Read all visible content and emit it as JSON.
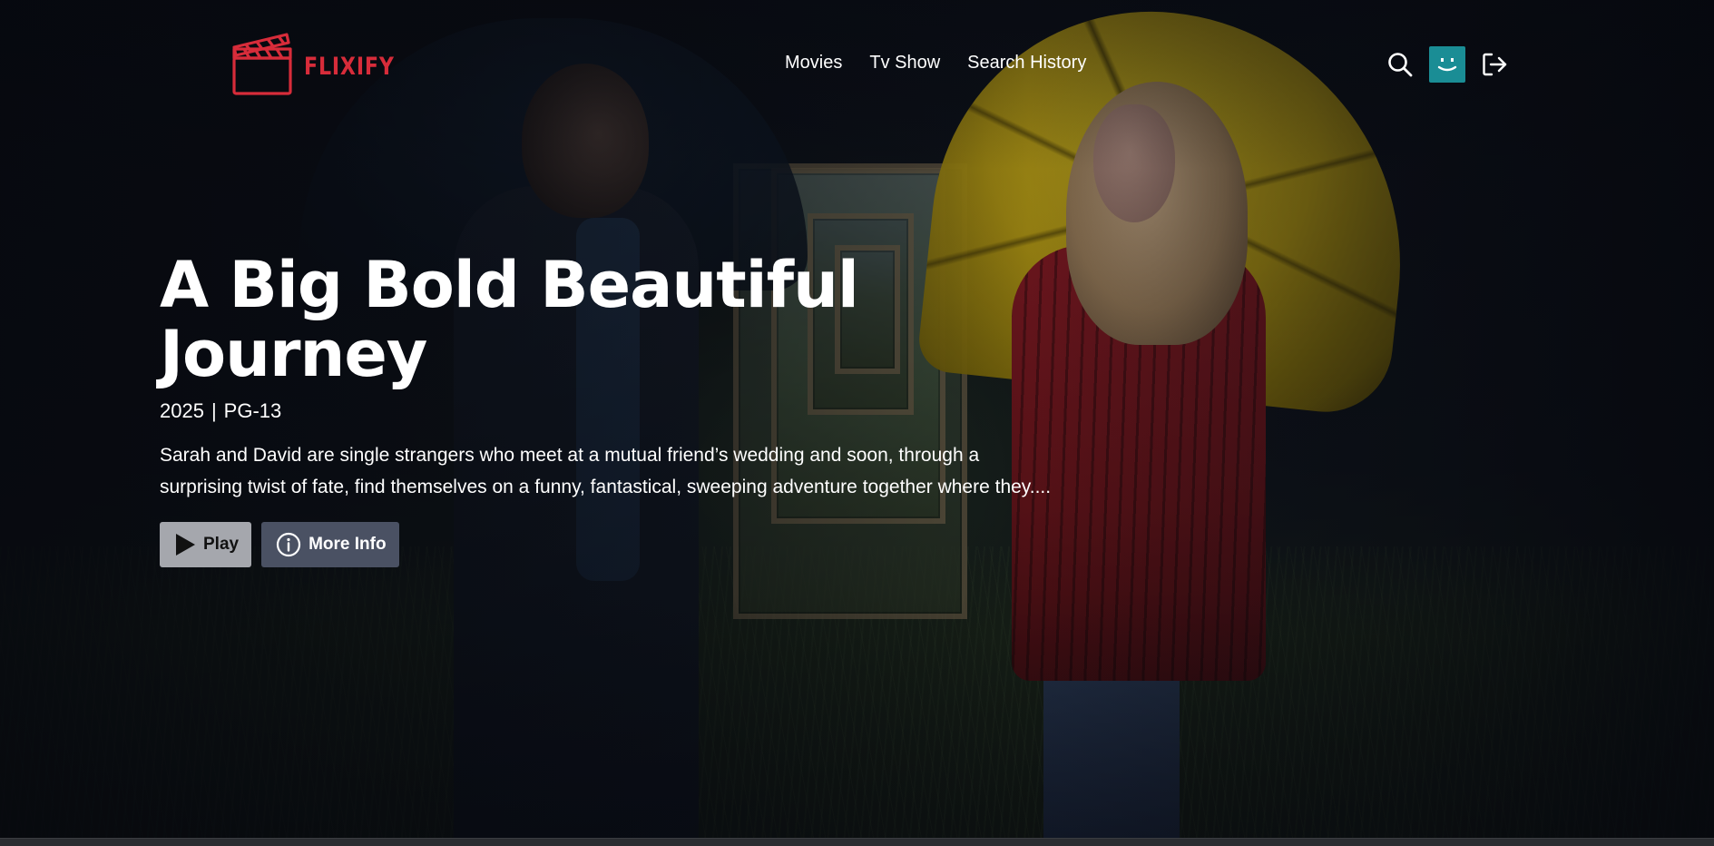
{
  "brand": {
    "name": "FLIXIFY",
    "color": "#d72c3a"
  },
  "nav": {
    "links": [
      "Movies",
      "Tv Show",
      "Search History"
    ]
  },
  "header_icons": {
    "search": "search-icon",
    "avatar": "smiley-avatar-icon",
    "avatar_color": "#1a8d95",
    "logout": "logout-icon"
  },
  "hero": {
    "title": "A Big Bold Beautiful Journey",
    "year": "2025",
    "separator": "|",
    "rating": "PG-13",
    "description": "Sarah and David are single strangers who meet at a mutual friend’s wedding and soon, through a surprising twist of fate, find themselves on a funny, fantastical, sweeping adventure together where they....",
    "play_label": "Play",
    "more_info_label": "More Info"
  }
}
